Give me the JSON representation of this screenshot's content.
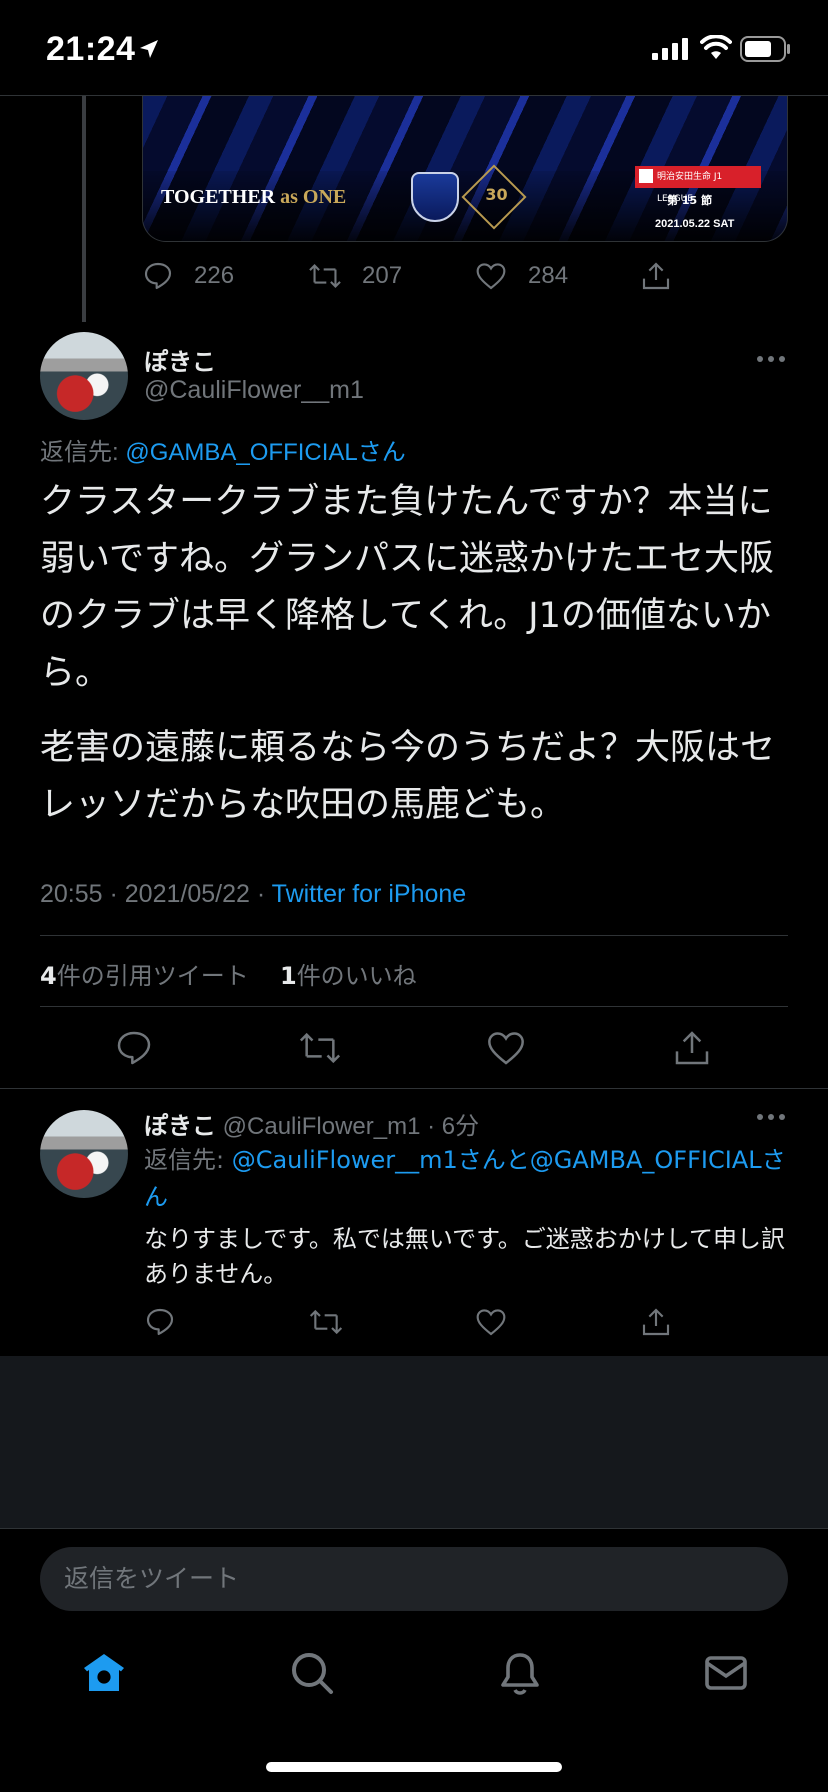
{
  "status_bar": {
    "time": "21:24"
  },
  "previous_tweet": {
    "media": {
      "slogan_main": "TOGETHER",
      "slogan_as": "as",
      "slogan_one": "ONE",
      "anniversary": "30",
      "league_text": "明治安田生命 J1 LEAGUE",
      "round": "第 15 節",
      "date": "2021.05.22  SAT"
    },
    "actions": {
      "replies": "226",
      "retweets": "207",
      "likes": "284"
    }
  },
  "main_tweet": {
    "display_name": "ぽきこ",
    "handle": "@CauliFlower__m1",
    "reply_to_label": "返信先: ",
    "reply_to_mention": "@GAMBA_OFFICIALさん",
    "text_p1": "クラスタークラブまた負けたんですか？本当に弱いですね。グランパスに迷惑かけたエセ大阪のクラブは早く降格してくれ。J1の価値ないから。",
    "text_p2": "老害の遠藤に頼るなら今のうちだよ？大阪はセレッソだからな吹田の馬鹿ども。",
    "timestamp": "20:55 · 2021/05/22 · ",
    "source": "Twitter for iPhone",
    "quote_count": "4",
    "quote_label": "件の引用ツイート",
    "like_count": "1",
    "like_label": "件のいいね"
  },
  "reply_tweet": {
    "display_name": "ぽきこ",
    "handle_time": " @CauliFlower_m1 · 6分",
    "reply_to_label": "返信先: ",
    "reply_to_mention": "@CauliFlower__m1さんと@GAMBA_OFFICIALさん",
    "text": "なりすましです。私では無いです。ご迷惑おかけして申し訳ありません。"
  },
  "composer": {
    "placeholder": "返信をツイート"
  },
  "colors": {
    "accent": "#1d9bf0",
    "secondary_text": "#71767b",
    "background": "#000000"
  },
  "icons": [
    "location-arrow-icon",
    "signal-icon",
    "wifi-icon",
    "battery-icon",
    "reply-icon",
    "retweet-icon",
    "like-icon",
    "share-icon",
    "more-icon",
    "home-icon",
    "search-icon",
    "bell-icon",
    "mail-icon"
  ]
}
